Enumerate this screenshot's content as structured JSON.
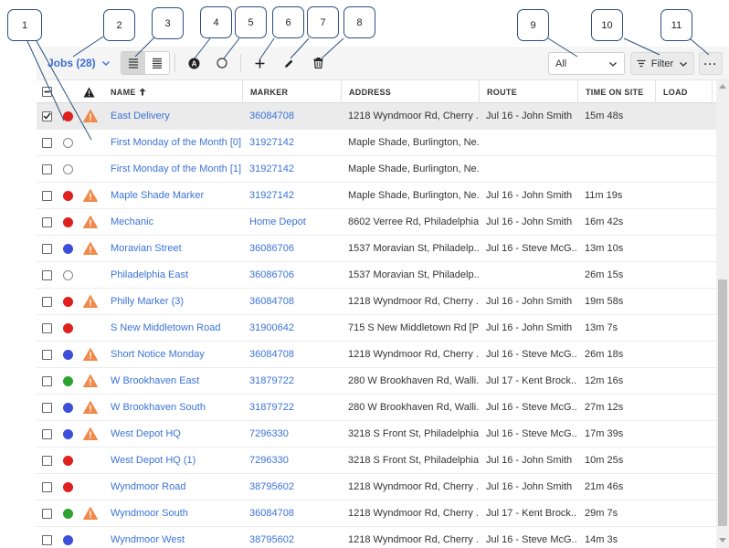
{
  "toolbar": {
    "jobs_label": "Jobs (28)",
    "select_value": "All",
    "filter_label": "Filter",
    "more_label": "···"
  },
  "callouts": [
    "1",
    "2",
    "3",
    "4",
    "5",
    "6",
    "7",
    "8",
    "9",
    "10",
    "11"
  ],
  "columns": {
    "name": "NAME",
    "marker": "MARKER",
    "address": "ADDRESS",
    "route": "ROUTE",
    "time": "TIME ON SITE",
    "load": "LOAD"
  },
  "colors": {
    "red": "#e0201e",
    "blue": "#3c4fd8",
    "green": "#2fa32f",
    "warning": "#f08a4b",
    "link": "#3b73d8"
  },
  "rows": [
    {
      "checked": true,
      "status": "red",
      "warn": true,
      "name": "East Delivery",
      "marker": "36084708",
      "address": "1218 Wyndmoor Rd, Cherry ...",
      "route": "Jul 16 - John Smith",
      "time": "15m 48s"
    },
    {
      "checked": false,
      "status": "hollow",
      "warn": false,
      "name": "First Monday of the Month [0]",
      "marker": "31927142",
      "address": "Maple Shade, Burlington, Ne...",
      "route": "",
      "time": ""
    },
    {
      "checked": false,
      "status": "hollow",
      "warn": false,
      "name": "First Monday of the Month [1]",
      "marker": "31927142",
      "address": "Maple Shade, Burlington, Ne...",
      "route": "",
      "time": ""
    },
    {
      "checked": false,
      "status": "red",
      "warn": true,
      "name": "Maple Shade Marker",
      "marker": "31927142",
      "address": "Maple Shade, Burlington, Ne...",
      "route": "Jul 16 - John Smith",
      "time": "11m 19s"
    },
    {
      "checked": false,
      "status": "red",
      "warn": true,
      "name": "Mechanic",
      "marker": "Home Depot",
      "address": "8602 Verree Rd, Philadelphia...",
      "route": "Jul 16 - John Smith",
      "time": "16m 42s"
    },
    {
      "checked": false,
      "status": "blue",
      "warn": true,
      "name": "Moravian Street",
      "marker": "36086706",
      "address": "1537 Moravian St, Philadelp...",
      "route": "Jul 16 - Steve McG...",
      "time": "13m 10s"
    },
    {
      "checked": false,
      "status": "hollow",
      "warn": false,
      "name": "Philadelphia East",
      "marker": "36086706",
      "address": "1537 Moravian St, Philadelp...",
      "route": "",
      "time": "26m 15s"
    },
    {
      "checked": false,
      "status": "red",
      "warn": true,
      "name": "Philly Marker (3)",
      "marker": "36084708",
      "address": "1218 Wyndmoor Rd, Cherry ...",
      "route": "Jul 16 - John Smith",
      "time": "19m 58s"
    },
    {
      "checked": false,
      "status": "red",
      "warn": false,
      "name": "S New Middletown Road",
      "marker": "31900642",
      "address": "715 S New Middletown Rd [P...",
      "route": "Jul 16 - John Smith",
      "time": "13m 7s"
    },
    {
      "checked": false,
      "status": "blue",
      "warn": true,
      "name": "Short Notice Monday",
      "marker": "36084708",
      "address": "1218 Wyndmoor Rd, Cherry ...",
      "route": "Jul 16 - Steve McG...",
      "time": "26m 18s"
    },
    {
      "checked": false,
      "status": "green",
      "warn": true,
      "name": "W Brookhaven East",
      "marker": "31879722",
      "address": "280 W Brookhaven Rd, Walli...",
      "route": "Jul 17 - Kent Brock...",
      "time": "12m 16s"
    },
    {
      "checked": false,
      "status": "blue",
      "warn": true,
      "name": "W Brookhaven South",
      "marker": "31879722",
      "address": "280 W Brookhaven Rd, Walli...",
      "route": "Jul 16 - Steve McG...",
      "time": "27m 12s"
    },
    {
      "checked": false,
      "status": "blue",
      "warn": true,
      "name": "West Depot HQ",
      "marker": "7296330",
      "address": "3218 S Front St, Philadelphia...",
      "route": "Jul 16 - Steve McG...",
      "time": "17m 39s"
    },
    {
      "checked": false,
      "status": "red",
      "warn": false,
      "name": "West Depot HQ (1)",
      "marker": "7296330",
      "address": "3218 S Front St, Philadelphia...",
      "route": "Jul 16 - John Smith",
      "time": "10m 25s"
    },
    {
      "checked": false,
      "status": "red",
      "warn": false,
      "name": "Wyndmoor Road",
      "marker": "38795602",
      "address": "1218 Wyndmoor Rd, Cherry ...",
      "route": "Jul 16 - John Smith",
      "time": "21m 46s"
    },
    {
      "checked": false,
      "status": "green",
      "warn": true,
      "name": "Wyndmoor South",
      "marker": "36084708",
      "address": "1218 Wyndmoor Rd, Cherry ...",
      "route": "Jul 17 - Kent Brock...",
      "time": "29m 7s"
    },
    {
      "checked": false,
      "status": "blue",
      "warn": false,
      "name": "Wyndmoor West",
      "marker": "38795602",
      "address": "1218 Wyndmoor Rd, Cherry ...",
      "route": "Jul 16 - Steve McG...",
      "time": "14m 3s"
    }
  ]
}
